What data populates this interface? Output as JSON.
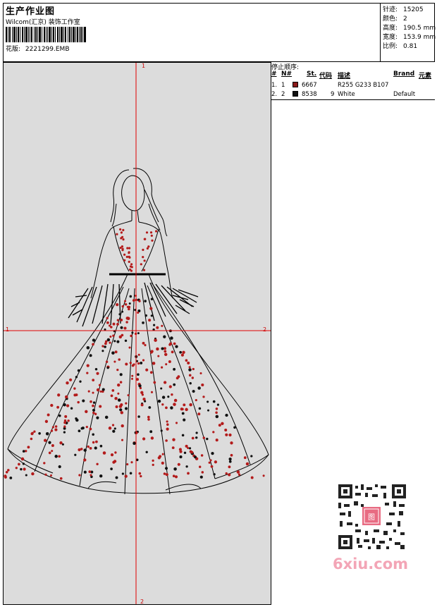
{
  "header": {
    "title": "生产作业图",
    "subtitle": "Wilcom(汇京) 装饰工作室",
    "design_label": "花版:",
    "design_no": "2221299.EMB"
  },
  "stats": [
    {
      "label": "针迹:",
      "value": "15205"
    },
    {
      "label": "颜色:",
      "value": "2"
    },
    {
      "label": "高度:",
      "value": "190.5 mm"
    },
    {
      "label": "宽度:",
      "value": "153.9 mm"
    },
    {
      "label": "比例:",
      "value": "0.81"
    }
  ],
  "thread_panel": {
    "heading": "停止顺序:",
    "columns": [
      "#",
      "N#",
      "St.",
      "代码",
      "描述",
      "Brand",
      "元素"
    ],
    "rows": [
      {
        "index": "1.",
        "n": "1",
        "color": "#8b1a1a",
        "code": "6667",
        "st": "",
        "desc": "R255 G233 B107",
        "brand": ""
      },
      {
        "index": "2.",
        "n": "2",
        "color": "#111111",
        "code": "8538",
        "st": "9",
        "desc": "White",
        "brand": "Default"
      }
    ]
  },
  "axis_labels": {
    "top": "1",
    "bottom": "2",
    "left": "1",
    "right": "2"
  },
  "watermark": {
    "text": "6xiu.com",
    "badge": "图"
  },
  "colors": {
    "red_thread": "#b31b1b",
    "black_thread": "#111111",
    "axis": "#e00000",
    "canvas": "#dcdcdc"
  }
}
